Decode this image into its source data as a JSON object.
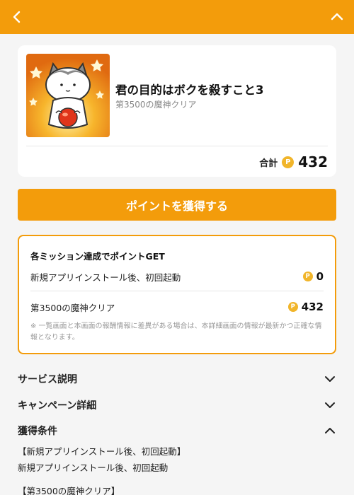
{
  "header": {
    "back_icon": "chevron-left-icon",
    "collapse_icon": "chevron-up-icon",
    "bg_color": "#f39c0b"
  },
  "app": {
    "title": "君の目的はボクを殺すこと3",
    "subtitle": "第3500の魔神クリア",
    "total_label": "合計",
    "total_value": "432",
    "coin_glyph": "P"
  },
  "cta": {
    "label": "ポイントを獲得する"
  },
  "missions": {
    "title": "各ミッション達成でポイントGET",
    "items": [
      {
        "label": "新規アプリインストール後、初回起動",
        "points": "0"
      },
      {
        "label": "第3500の魔神クリア",
        "points": "432"
      }
    ],
    "note": "※ 一覧画面と本画面の報酬情報に差異がある場合は、本詳細画面の情報が最新かつ正確な情報となります。"
  },
  "sections": [
    {
      "title": "サービス説明",
      "state": "collapsed"
    },
    {
      "title": "キャンペーン詳細",
      "state": "collapsed"
    },
    {
      "title": "獲得条件",
      "state": "expanded"
    }
  ],
  "conditions": {
    "heading1": "【新規アプリインストール後、初回起動】",
    "text1": "新規アプリインストール後、初回起動",
    "heading2": "【第3500の魔神クリア】"
  },
  "colors": {
    "accent": "#f39c0b",
    "coin": "#f1b52a"
  }
}
